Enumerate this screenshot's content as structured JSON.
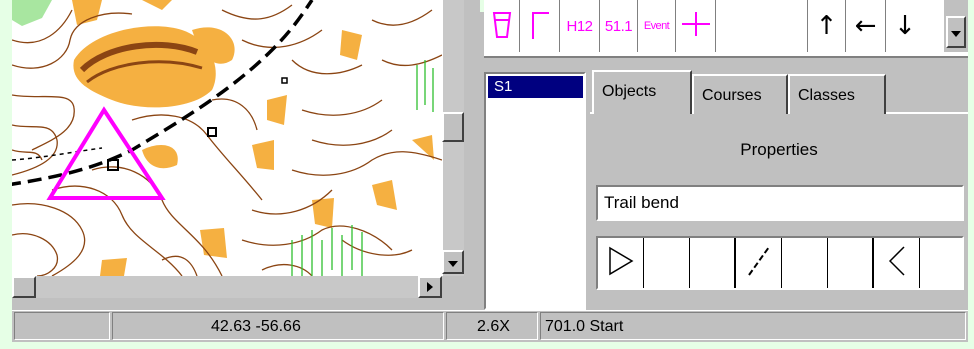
{
  "toolbar": {
    "symbols": [
      {
        "icon": "water-tank-icon",
        "label": ""
      },
      {
        "icon": "corner-line-icon",
        "label": ""
      },
      {
        "icon": "",
        "label": "H12"
      },
      {
        "icon": "",
        "label": "51.1"
      },
      {
        "icon": "",
        "label": "Event"
      },
      {
        "icon": "cross-icon",
        "label": ""
      },
      {
        "icon": "blank",
        "label": ""
      },
      {
        "icon": "arrow-up-icon",
        "label": "↑"
      },
      {
        "icon": "arrow-left-icon",
        "label": "←"
      },
      {
        "icon": "arrow-down-icon",
        "label": "↓"
      }
    ]
  },
  "course_list": {
    "items": [
      "S1"
    ],
    "selected": "S1"
  },
  "tabs": [
    "Objects",
    "Courses",
    "Classes"
  ],
  "active_tab": "Objects",
  "properties": {
    "label": "Properties",
    "description_value": "Trail bend"
  },
  "description_symbols": [
    "triangle-start-icon",
    "blank",
    "blank",
    "trail-slash-icon",
    "blank",
    "blank",
    "bend-left-icon",
    "blank"
  ],
  "status_bar": {
    "segment_1": "",
    "coordinates": "42.63   -56.66",
    "zoom": "2.6X",
    "info": "701.0 Start"
  },
  "colors": {
    "accent_magenta": "#ff00ff",
    "selection_blue": "#000080",
    "map_contour_brown": "#8b4513",
    "map_yellow_open": "#f5b041",
    "frame_green": "#e6ffe6"
  }
}
